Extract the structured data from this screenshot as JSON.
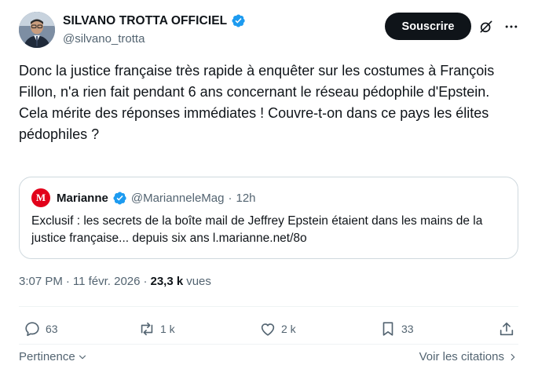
{
  "author": {
    "display_name": "SILVANO TROTTA OFFICIEL",
    "handle": "@silvano_trotta",
    "verified": true,
    "verified_color": "#1d9bf0",
    "avatar_icon": "profile-photo"
  },
  "header": {
    "subscribe_label": "Souscrire",
    "grok_icon": "slashed-circle-icon",
    "more_icon": "more-horizontal-icon"
  },
  "tweet": {
    "paragraph_1": "Donc la justice française très rapide à enquêter sur les costumes à François Fillon, n'a rien fait pendant 6 ans concernant le réseau pédophile d'Epstein.",
    "paragraph_2": "Cela mérite des réponses immédiates !  Couvre-t-on dans ce pays les élites pédophiles ?"
  },
  "quote": {
    "avatar_letter": "M",
    "avatar_color": "#e2001a",
    "name": "Marianne",
    "handle": "@MarianneleMag",
    "separator": "·",
    "time": "12h",
    "text": "Exclusif : les secrets de la boîte mail de Jeffrey Epstein étaient dans les mains de la justice française... depuis six ans l.marianne.net/8o"
  },
  "meta": {
    "time": "3:07 PM",
    "separator": "·",
    "date": "11 févr. 2026",
    "views_count": "23,3 k",
    "views_label": "vues"
  },
  "actions": {
    "replies": "63",
    "reposts": "1 k",
    "likes": "2 k",
    "bookmarks": "33"
  },
  "footer": {
    "sort_label": "Pertinence",
    "see_quotes_label": "Voir les citations"
  }
}
